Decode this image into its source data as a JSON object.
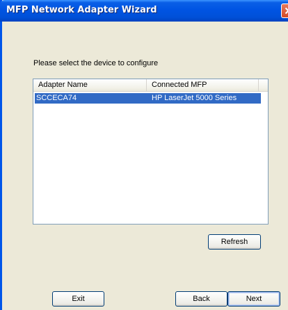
{
  "window": {
    "title": "MFP Network Adapter Wizard"
  },
  "prompt": "Please select the device to configure",
  "list": {
    "columns": [
      "Adapter Name",
      "Connected MFP"
    ],
    "rows": [
      {
        "adapter_name": "SCCECA74",
        "connected_mfp": "HP LaserJet 5000 Series",
        "selected": true
      }
    ]
  },
  "buttons": {
    "refresh": "Refresh",
    "exit": "Exit",
    "back": "Back",
    "next": "Next"
  },
  "colors": {
    "titlebar": "#0054e3",
    "selection": "#316ac5",
    "dialog_bg": "#ece9d8"
  },
  "icons": {
    "close": "close-icon"
  }
}
